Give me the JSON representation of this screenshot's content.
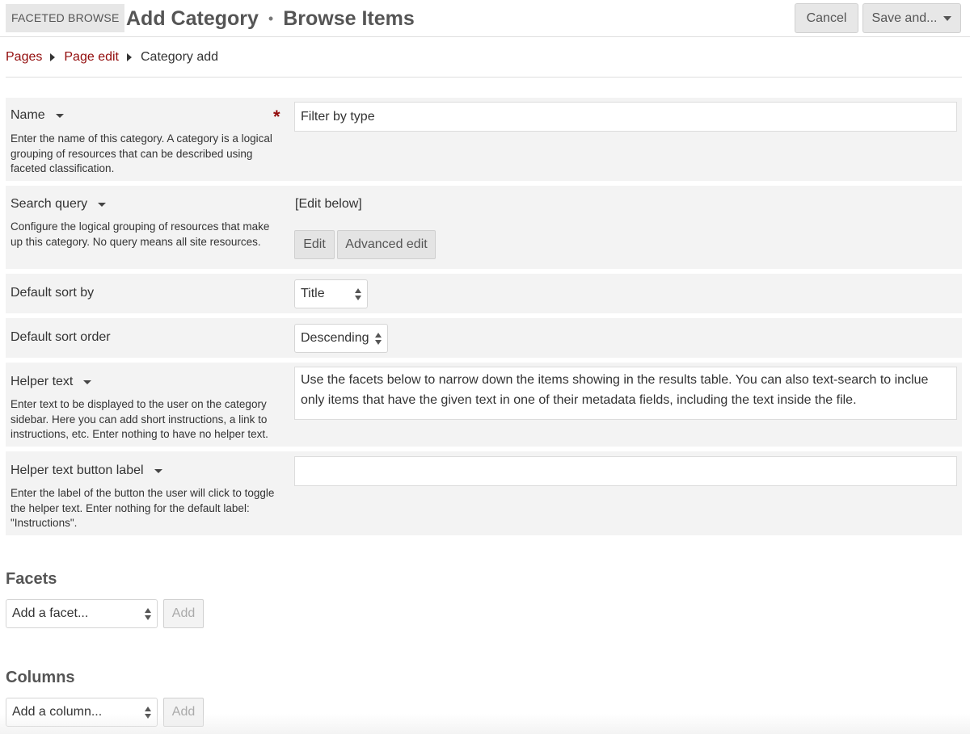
{
  "header": {
    "module_badge": "FACETED BROWSE",
    "title": "Add Category",
    "separator": "•",
    "subtitle": "Browse Items",
    "cancel_label": "Cancel",
    "save_label": "Save and..."
  },
  "breadcrumb": {
    "items": [
      "Pages",
      "Page edit",
      "Category add"
    ]
  },
  "fields": {
    "name": {
      "label": "Name",
      "description": "Enter the name of this category. A category is a logical grouping of resources that can be described using faceted classification.",
      "required_mark": "*",
      "value": "Filter by type"
    },
    "search_query": {
      "label": "Search query",
      "description": "Configure the logical grouping of resources that make up this category. No query means all site resources.",
      "value": "[Edit below]",
      "edit_label": "Edit",
      "advanced_edit_label": "Advanced edit"
    },
    "default_sort_by": {
      "label": "Default sort by",
      "selected": "Title"
    },
    "default_sort_order": {
      "label": "Default sort order",
      "selected": "Descending"
    },
    "helper_text": {
      "label": "Helper text",
      "description": "Enter text to be displayed to the user on the category sidebar. Here you can add short instructions, a link to instructions, etc. Enter nothing to have no helper text.",
      "value": "Use the facets below to narrow down the items showing in the results table. You can also text-search to inclue only items that have the given text in one of their metadata fields, including the text inside the file."
    },
    "helper_text_button_label": {
      "label": "Helper text button label",
      "description": "Enter the label of the button the user will click to toggle the helper text. Enter nothing for the default label: \"Instructions\".",
      "value": ""
    }
  },
  "facets": {
    "title": "Facets",
    "select_placeholder": "Add a facet...",
    "add_label": "Add"
  },
  "columns": {
    "title": "Columns",
    "select_placeholder": "Add a column...",
    "add_label": "Add"
  },
  "colors": {
    "link": "#920b0b",
    "row_background": "#f3f3f3",
    "button_background": "#e7e7e7"
  }
}
